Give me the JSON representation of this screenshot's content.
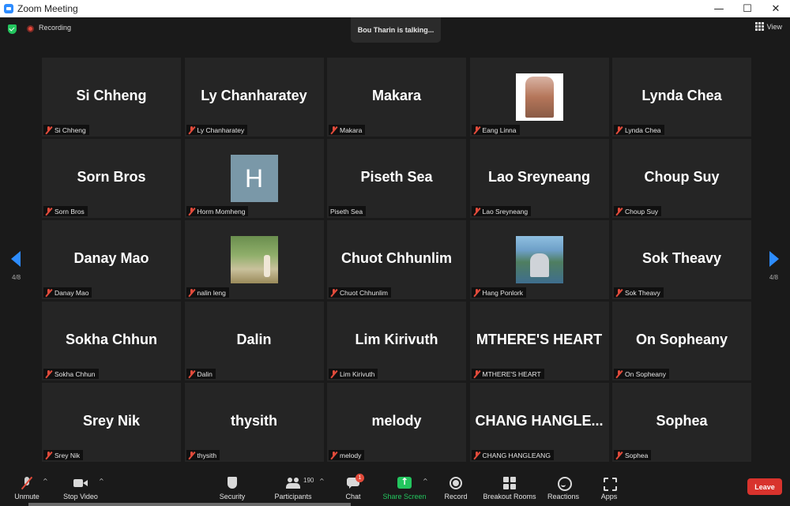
{
  "window": {
    "title": "Zoom Meeting",
    "controls": [
      "—",
      "☐",
      "✕"
    ]
  },
  "topbar": {
    "recording_label": "Recording",
    "talking_text": "Bou Tharin is talking...",
    "view_label": "View"
  },
  "pagination": {
    "left_indicator": "4/8",
    "right_indicator": "4/8"
  },
  "participants": [
    {
      "display": "Si Chheng",
      "label": "Si Chheng",
      "muted": true,
      "avatar": "none"
    },
    {
      "display": "Ly Chanharatey",
      "label": "Ly Chanharatey",
      "muted": true,
      "avatar": "none"
    },
    {
      "display": "Makara",
      "label": "Makara",
      "muted": true,
      "avatar": "none"
    },
    {
      "display": "",
      "label": "Eang Linna",
      "muted": true,
      "avatar": "photo"
    },
    {
      "display": "Lynda Chea",
      "label": "Lynda Chea",
      "muted": true,
      "avatar": "none"
    },
    {
      "display": "Sorn Bros",
      "label": "Sorn Bros",
      "muted": true,
      "avatar": "none"
    },
    {
      "display": "",
      "label": "Horm Momheng",
      "muted": true,
      "avatar": "letter",
      "letter": "H"
    },
    {
      "display": "Piseth Sea",
      "label": "Piseth Sea",
      "muted": false,
      "avatar": "none"
    },
    {
      "display": "Lao Sreyneang",
      "label": "Lao Sreyneang",
      "muted": true,
      "avatar": "none"
    },
    {
      "display": "Choup Suy",
      "label": "Choup Suy",
      "muted": true,
      "avatar": "none"
    },
    {
      "display": "Danay Mao",
      "label": "Danay Mao",
      "muted": true,
      "avatar": "none"
    },
    {
      "display": "",
      "label": "nalin leng",
      "muted": true,
      "avatar": "photo"
    },
    {
      "display": "Chuot Chhunlim",
      "label": "Chuot Chhunlim",
      "muted": true,
      "avatar": "none"
    },
    {
      "display": "",
      "label": "Hang Ponlork",
      "muted": true,
      "avatar": "photo"
    },
    {
      "display": "Sok Theavy",
      "label": "Sok Theavy",
      "muted": true,
      "avatar": "none"
    },
    {
      "display": "Sokha Chhun",
      "label": "Sokha Chhun",
      "muted": true,
      "avatar": "none"
    },
    {
      "display": "Dalin",
      "label": "Dalin",
      "muted": true,
      "avatar": "none"
    },
    {
      "display": "Lim Kirivuth",
      "label": "Lim Kirivuth",
      "muted": true,
      "avatar": "none"
    },
    {
      "display": "MTHERE'S HEART",
      "label": "MTHERE'S HEART",
      "muted": true,
      "avatar": "none"
    },
    {
      "display": "On Sopheany",
      "label": "On Sopheany",
      "muted": true,
      "avatar": "none"
    },
    {
      "display": "Srey Nik",
      "label": "Srey Nik",
      "muted": true,
      "avatar": "none"
    },
    {
      "display": "thysith",
      "label": "thysith",
      "muted": true,
      "avatar": "none"
    },
    {
      "display": "melody",
      "label": "melody",
      "muted": true,
      "avatar": "none"
    },
    {
      "display": "CHANG  HANGLE...",
      "label": "CHANG HANGLEANG",
      "muted": true,
      "avatar": "none"
    },
    {
      "display": "Sophea",
      "label": "Sophea",
      "muted": true,
      "avatar": "none"
    }
  ],
  "toolbar": {
    "unmute": "Unmute",
    "stop_video": "Stop Video",
    "security": "Security",
    "participants": "Participants",
    "participants_count": "190",
    "chat": "Chat",
    "chat_badge": "1",
    "share_screen": "Share Screen",
    "record": "Record",
    "breakout_rooms": "Breakout Rooms",
    "reactions": "Reactions",
    "apps": "Apps",
    "leave": "Leave",
    "caret": "^"
  },
  "colors": {
    "accent_blue": "#2d8cff",
    "share_green": "#23c55e",
    "leave_red": "#d8332d",
    "muted_red": "#e24b3b",
    "tile_bg": "#252525"
  }
}
